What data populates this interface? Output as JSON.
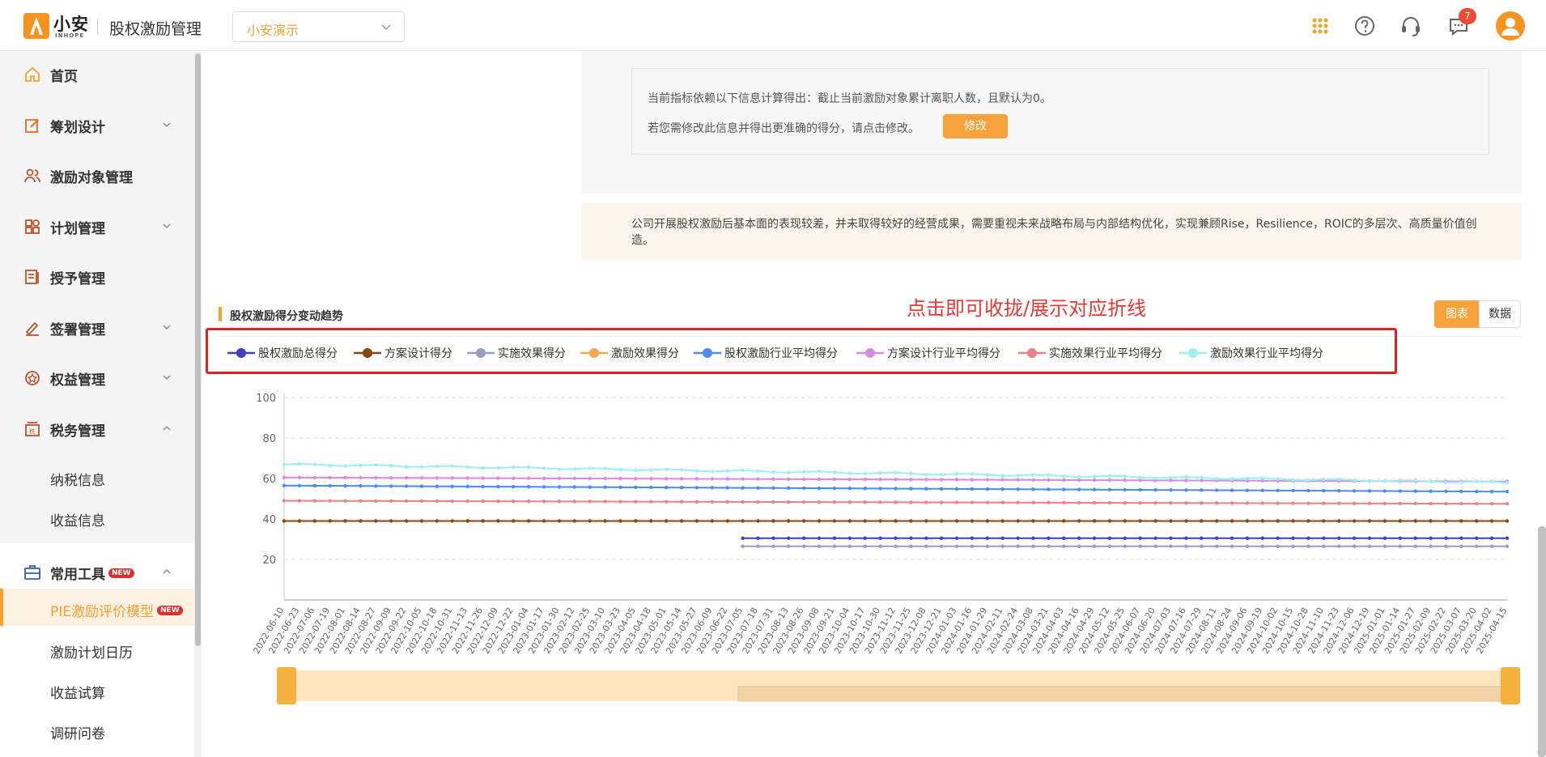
{
  "header": {
    "logo_text": "小安",
    "logo_sub": "INHOPE",
    "app_title": "股权激励管理",
    "company": "小安演示",
    "notification_count": "7",
    "icons": [
      "apps-grid-icon",
      "help-icon",
      "customer-service-icon",
      "message-icon",
      "user-avatar-icon"
    ]
  },
  "sidebar": {
    "items": [
      {
        "label": "首页",
        "icon": "home-icon"
      },
      {
        "label": "筹划设计",
        "icon": "edit-icon"
      },
      {
        "label": "激励对象管理",
        "icon": "users-icon"
      },
      {
        "label": "计划管理",
        "icon": "grid-icon"
      },
      {
        "label": "授予管理",
        "icon": "book-icon"
      },
      {
        "label": "签署管理",
        "icon": "sign-icon"
      },
      {
        "label": "权益管理",
        "icon": "badge-icon"
      },
      {
        "label": "税务管理",
        "icon": "tax-icon"
      }
    ],
    "tax_sub": [
      "纳税信息",
      "收益信息"
    ],
    "tools": {
      "label": "常用工具",
      "new": "NEW",
      "icon": "toolbox-icon"
    },
    "tools_sub": [
      {
        "label": "PIE激励评价模型",
        "new": "NEW"
      },
      {
        "label": "激励计划日历"
      },
      {
        "label": "收益试算"
      },
      {
        "label": "调研问卷"
      }
    ]
  },
  "info": {
    "line1": "当前指标依赖以下信息计算得出：截止当前激励对象累计离职人数，且默认为0。",
    "line2": "若您需修改此信息并得出更准确的得分，请点击修改。",
    "edit_button": "修改"
  },
  "conclusion": "公司开展股权激励后基本面的表现较差，并未取得较好的经营成果，需要重视未来战略布局与内部结构优化，实现兼顾Rise，Resilience，ROIC的多层次、高质量价值创造。",
  "section_title": "股权激励得分变动趋势",
  "annotation": "点击即可收拢/展示对应折线",
  "view_toggle": {
    "chart": "图表",
    "data": "数据"
  },
  "chart_data": {
    "type": "line",
    "title": "",
    "ylim": [
      0,
      100
    ],
    "yticks": [
      20,
      40,
      60,
      80,
      100
    ],
    "grid": true,
    "legend_position": "top",
    "x": [
      "2022-06-10",
      "2022-06-23",
      "2022-07-06",
      "2022-07-19",
      "2022-08-01",
      "2022-08-14",
      "2022-08-27",
      "2022-09-09",
      "2022-09-22",
      "2022-10-05",
      "2022-10-18",
      "2022-10-31",
      "2022-11-13",
      "2022-11-26",
      "2022-12-09",
      "2022-12-22",
      "2023-01-04",
      "2023-01-17",
      "2023-01-30",
      "2023-02-12",
      "2023-02-25",
      "2023-03-10",
      "2023-03-23",
      "2023-04-05",
      "2023-04-18",
      "2023-05-01",
      "2023-05-14",
      "2023-05-27",
      "2023-06-09",
      "2023-06-22",
      "2023-07-05",
      "2023-07-18",
      "2023-07-31",
      "2023-08-13",
      "2023-08-26",
      "2023-09-08",
      "2023-09-21",
      "2023-10-04",
      "2023-10-17",
      "2023-10-30",
      "2023-11-12",
      "2023-11-25",
      "2023-12-08",
      "2023-12-21",
      "2024-01-03",
      "2024-01-16",
      "2024-01-29",
      "2024-02-11",
      "2024-02-24",
      "2024-03-08",
      "2024-03-21",
      "2024-04-03",
      "2024-04-16",
      "2024-04-29",
      "2024-05-12",
      "2024-05-25",
      "2024-06-07",
      "2024-06-20",
      "2024-07-03",
      "2024-07-16",
      "2024-07-29",
      "2024-08-11",
      "2024-08-24",
      "2024-09-06",
      "2024-09-19",
      "2024-10-02",
      "2024-10-15",
      "2024-10-28",
      "2024-11-10",
      "2024-11-23",
      "2024-12-06",
      "2024-12-19",
      "2025-01-01",
      "2025-01-14",
      "2025-01-27",
      "2025-02-09",
      "2025-02-22",
      "2025-03-07",
      "2025-03-20",
      "2025-04-02",
      "2025-04-15"
    ],
    "series": [
      {
        "name": "股权激励总得分",
        "color": "#3f3fbf",
        "start_index": 30,
        "start": 30.5,
        "end": 30.5
      },
      {
        "name": "方案设计得分",
        "color": "#8b4513",
        "start_index": 0,
        "start": 39,
        "end": 39
      },
      {
        "name": "实施效果得分",
        "color": "#9a9ac8",
        "start_index": 30,
        "start": 26.5,
        "end": 26.5
      },
      {
        "name": "激励效果得分",
        "color": "#f5a94a",
        "start_index": 0,
        "start": null,
        "end": null
      },
      {
        "name": "股权激励行业平均得分",
        "color": "#4a8cf0",
        "start_index": 0,
        "start": 56.5,
        "end": 53.5
      },
      {
        "name": "方案设计行业平均得分",
        "color": "#d88ce0",
        "start_index": 0,
        "start": 60.5,
        "end": 58.5
      },
      {
        "name": "实施效果行业平均得分",
        "color": "#e88484",
        "start_index": 0,
        "start": 49,
        "end": 47.5
      },
      {
        "name": "激励效果行业平均得分",
        "color": "#9cf0f0",
        "start_index": 0,
        "start": 67,
        "end": 58
      }
    ]
  }
}
